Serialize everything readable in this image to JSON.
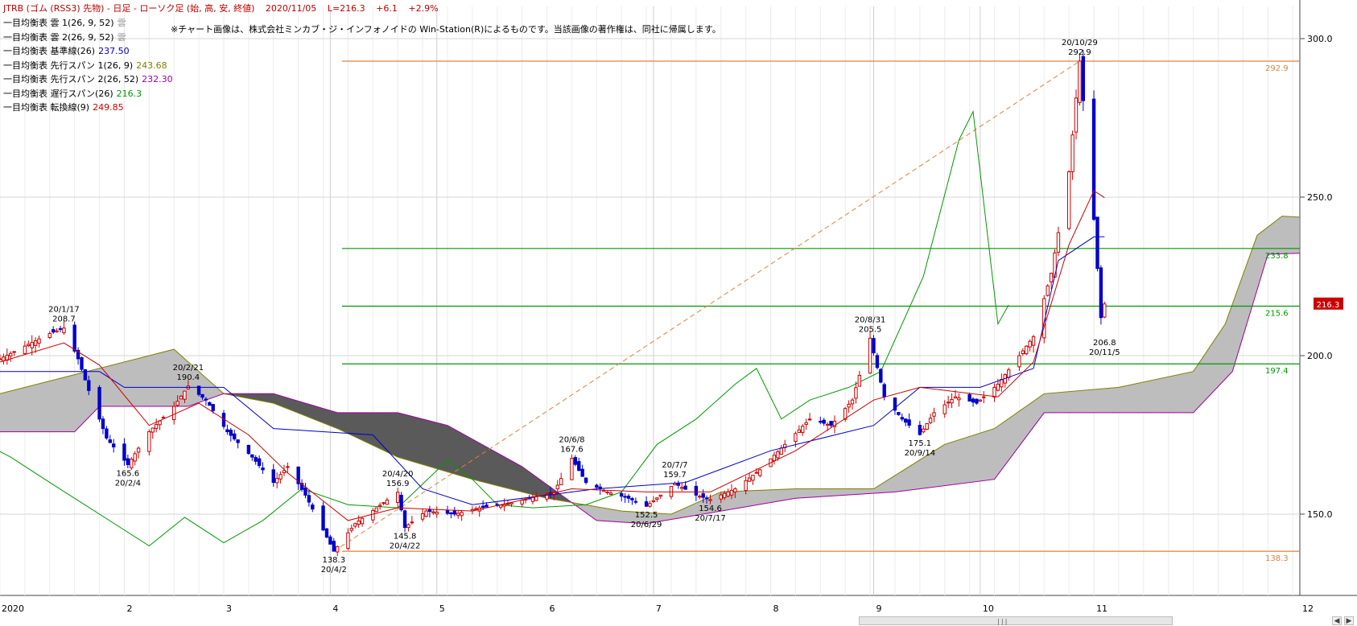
{
  "header": {
    "title": "JTRB (ゴム (RSS3) 先物) - 日足 - ローソク足 (始, 高, 安, 終値)",
    "date": "2020/11/05",
    "last": "L=216.3",
    "change": "+6.1",
    "pct": "+2.9%"
  },
  "legend": [
    {
      "label": "一目均衡表 雲 1(26, 9, 52)",
      "value": "雲",
      "color": "#999999"
    },
    {
      "label": "一目均衡表 雲 2(26, 9, 52)",
      "value": "雲",
      "color": "#999999"
    },
    {
      "label": "一目均衡表 基準線(26)",
      "value": "237.50",
      "color": "#0000cc"
    },
    {
      "label": "一目均衡表 先行スパン 1(26, 9)",
      "value": "243.68",
      "color": "#808000"
    },
    {
      "label": "一目均衡表 先行スパン 2(26, 52)",
      "value": "232.30",
      "color": "#a000a0"
    },
    {
      "label": "一目均衡表 遅行スパン(26)",
      "value": "216.3",
      "color": "#009900"
    },
    {
      "label": "一目均衡表 転換線(9)",
      "value": "249.85",
      "color": "#cc0000"
    }
  ],
  "note": "※チャート画像は、株式会社ミンカブ・ジ・インフォノイドの Win-Station(R)によるものです。当該画像の著作権は、同社に帰属します。",
  "colors": {
    "up": "#cc0000",
    "down": "#0000cc",
    "kijun": "#0000cc",
    "tenkan": "#cc0000",
    "chikou": "#009900",
    "span1": "#808000",
    "span2": "#a000a0",
    "cloud_bull": "#bdbdbd",
    "cloud_bear": "#5a5a5a",
    "hline_green": "#009900",
    "hline_orange": "#e08040",
    "price_box": "#cc0000"
  },
  "chart_data": {
    "type": "candlestick",
    "ylim": [
      130,
      305
    ],
    "yticks": [
      "300.0",
      "250.0",
      "200.0",
      "150.0"
    ],
    "months": [
      "2020",
      "2",
      "3",
      "4",
      "5",
      "6",
      "7",
      "8",
      "9",
      "10",
      "11",
      "12"
    ],
    "current_price_label": "216.3",
    "hlines": [
      {
        "value": 292.9,
        "label": "292.9",
        "color": "orange"
      },
      {
        "value": 233.8,
        "label": "233.8",
        "color": "green"
      },
      {
        "value": 215.6,
        "label": "215.6",
        "color": "green"
      },
      {
        "value": 197.4,
        "label": "197.4",
        "color": "green"
      },
      {
        "value": 138.3,
        "label": "138.3",
        "color": "orange"
      }
    ],
    "trendline": {
      "from": [
        "20/4/2",
        138.3
      ],
      "to": [
        "20/10/29",
        292.9
      ]
    },
    "annotations": [
      {
        "date": "20/1/17",
        "value": "208.7",
        "pos": "above"
      },
      {
        "date": "20/2/4",
        "value": "165.6",
        "pos": "below"
      },
      {
        "date": "20/2/21",
        "value": "190.4",
        "pos": "above"
      },
      {
        "date": "20/4/2",
        "value": "138.3",
        "pos": "below"
      },
      {
        "date": "20/4/20",
        "value": "156.9",
        "pos": "above"
      },
      {
        "date": "20/4/22",
        "value": "145.8",
        "pos": "below"
      },
      {
        "date": "20/6/8",
        "value": "167.6",
        "pos": "above"
      },
      {
        "date": "20/6/29",
        "value": "152.5",
        "pos": "below"
      },
      {
        "date": "20/7/7",
        "value": "159.7",
        "pos": "above"
      },
      {
        "date": "20/7/17",
        "value": "154.6",
        "pos": "below"
      },
      {
        "date": "20/8/31",
        "value": "205.5",
        "pos": "above"
      },
      {
        "date": "20/9/14",
        "value": "175.1",
        "pos": "below"
      },
      {
        "date": "20/10/29",
        "value": "292.9",
        "pos": "above"
      },
      {
        "date": "20/11/5",
        "value": "206.8",
        "pos": "below"
      }
    ],
    "price_path": [
      [
        "2019-12-30",
        199
      ],
      [
        "2020-01-06",
        203
      ],
      [
        "2020-01-13",
        207
      ],
      [
        "2020-01-17",
        208.7
      ],
      [
        "2020-01-21",
        199
      ],
      [
        "2020-01-24",
        189
      ],
      [
        "2020-01-29",
        174
      ],
      [
        "2020-02-04",
        165.6
      ],
      [
        "2020-02-10",
        176
      ],
      [
        "2020-02-17",
        184
      ],
      [
        "2020-02-21",
        190.4
      ],
      [
        "2020-02-26",
        186
      ],
      [
        "2020-03-03",
        176
      ],
      [
        "2020-03-10",
        168
      ],
      [
        "2020-03-16",
        160
      ],
      [
        "2020-03-20",
        165
      ],
      [
        "2020-03-25",
        156
      ],
      [
        "2020-03-30",
        145
      ],
      [
        "2020-04-02",
        138.3
      ],
      [
        "2020-04-08",
        147
      ],
      [
        "2020-04-14",
        152
      ],
      [
        "2020-04-20",
        156.9
      ],
      [
        "2020-04-22",
        145.8
      ],
      [
        "2020-04-28",
        151
      ],
      [
        "2020-05-06",
        150
      ],
      [
        "2020-05-13",
        152
      ],
      [
        "2020-05-20",
        153
      ],
      [
        "2020-05-27",
        155
      ],
      [
        "2020-06-03",
        157
      ],
      [
        "2020-06-08",
        167.6
      ],
      [
        "2020-06-12",
        160
      ],
      [
        "2020-06-18",
        157
      ],
      [
        "2020-06-24",
        155
      ],
      [
        "2020-06-29",
        152.5
      ],
      [
        "2020-07-03",
        156
      ],
      [
        "2020-07-07",
        159.7
      ],
      [
        "2020-07-13",
        156
      ],
      [
        "2020-07-17",
        154.6
      ],
      [
        "2020-07-24",
        158
      ],
      [
        "2020-07-31",
        164
      ],
      [
        "2020-08-07",
        172
      ],
      [
        "2020-08-14",
        180
      ],
      [
        "2020-08-20",
        178
      ],
      [
        "2020-08-26",
        186
      ],
      [
        "2020-08-31",
        205.5
      ],
      [
        "2020-09-04",
        187
      ],
      [
        "2020-09-09",
        180
      ],
      [
        "2020-09-14",
        175.1
      ],
      [
        "2020-09-18",
        182
      ],
      [
        "2020-09-24",
        187
      ],
      [
        "2020-09-30",
        185
      ],
      [
        "2020-10-06",
        191
      ],
      [
        "2020-10-12",
        200
      ],
      [
        "2020-10-16",
        206
      ],
      [
        "2020-10-21",
        226
      ],
      [
        "2020-10-26",
        258
      ],
      [
        "2020-10-29",
        292.9
      ],
      [
        "2020-11-02",
        243
      ],
      [
        "2020-11-04",
        212
      ],
      [
        "2020-11-05",
        216.3
      ]
    ],
    "kijun_path": [
      [
        "2019-12-30",
        195
      ],
      [
        "2020-01-27",
        195
      ],
      [
        "2020-02-03",
        190
      ],
      [
        "2020-03-02",
        190
      ],
      [
        "2020-03-16",
        177
      ],
      [
        "2020-04-13",
        175
      ],
      [
        "2020-04-27",
        158
      ],
      [
        "2020-05-11",
        153
      ],
      [
        "2020-06-15",
        158
      ],
      [
        "2020-07-10",
        160
      ],
      [
        "2020-08-03",
        170
      ],
      [
        "2020-09-01",
        178
      ],
      [
        "2020-09-14",
        190
      ],
      [
        "2020-10-01",
        190
      ],
      [
        "2020-10-16",
        196
      ],
      [
        "2020-10-23",
        230
      ],
      [
        "2020-11-02",
        237.5
      ],
      [
        "2020-11-05",
        237.5
      ]
    ],
    "tenkan_path": [
      [
        "2019-12-30",
        198
      ],
      [
        "2020-01-17",
        204
      ],
      [
        "2020-01-27",
        197
      ],
      [
        "2020-02-10",
        178
      ],
      [
        "2020-02-24",
        185
      ],
      [
        "2020-03-09",
        175
      ],
      [
        "2020-03-20",
        163
      ],
      [
        "2020-04-06",
        148
      ],
      [
        "2020-04-20",
        152
      ],
      [
        "2020-05-11",
        151
      ],
      [
        "2020-06-08",
        158
      ],
      [
        "2020-06-29",
        157
      ],
      [
        "2020-07-17",
        157
      ],
      [
        "2020-08-10",
        170
      ],
      [
        "2020-09-01",
        186
      ],
      [
        "2020-09-14",
        190
      ],
      [
        "2020-10-06",
        187
      ],
      [
        "2020-10-16",
        198
      ],
      [
        "2020-10-26",
        235
      ],
      [
        "2020-11-02",
        252
      ],
      [
        "2020-11-05",
        249.85
      ]
    ],
    "chikou_path": [
      [
        "2019-12-02",
        182
      ],
      [
        "2019-12-16",
        178
      ],
      [
        "2020-01-02",
        168
      ],
      [
        "2020-01-13",
        160
      ],
      [
        "2020-01-27",
        150
      ],
      [
        "2020-02-10",
        140
      ],
      [
        "2020-02-20",
        149
      ],
      [
        "2020-03-02",
        141
      ],
      [
        "2020-03-13",
        148
      ],
      [
        "2020-03-24",
        158
      ],
      [
        "2020-04-06",
        153
      ],
      [
        "2020-04-20",
        152
      ],
      [
        "2020-05-04",
        167
      ],
      [
        "2020-05-11",
        161
      ],
      [
        "2020-05-18",
        153
      ],
      [
        "2020-05-28",
        152
      ],
      [
        "2020-06-12",
        153
      ],
      [
        "2020-06-22",
        157
      ],
      [
        "2020-07-02",
        172
      ],
      [
        "2020-07-13",
        180
      ],
      [
        "2020-07-24",
        191
      ],
      [
        "2020-07-30",
        196
      ],
      [
        "2020-08-06",
        180
      ],
      [
        "2020-08-14",
        186
      ],
      [
        "2020-08-25",
        190
      ],
      [
        "2020-09-03",
        195
      ],
      [
        "2020-09-15",
        225
      ],
      [
        "2020-09-25",
        268
      ],
      [
        "2020-09-29",
        277
      ],
      [
        "2020-10-06",
        210
      ],
      [
        "2020-10-09",
        216
      ]
    ],
    "span1_path": [
      [
        "2019-12-30",
        188
      ],
      [
        "2020-01-20",
        194
      ],
      [
        "2020-02-10",
        200
      ],
      [
        "2020-02-17",
        202
      ],
      [
        "2020-03-02",
        188
      ],
      [
        "2020-03-16",
        185
      ],
      [
        "2020-04-03",
        177
      ],
      [
        "2020-04-20",
        168
      ],
      [
        "2020-05-11",
        161
      ],
      [
        "2020-06-01",
        155
      ],
      [
        "2020-06-22",
        151
      ],
      [
        "2020-07-06",
        150
      ],
      [
        "2020-07-20",
        157
      ],
      [
        "2020-08-10",
        158
      ],
      [
        "2020-09-01",
        158
      ],
      [
        "2020-09-21",
        172
      ],
      [
        "2020-10-05",
        177
      ],
      [
        "2020-10-19",
        188
      ],
      [
        "2020-11-09",
        190
      ],
      [
        "2020-11-30",
        195
      ],
      [
        "2020-12-09",
        210
      ],
      [
        "2020-12-18",
        238
      ],
      [
        "2020-12-25",
        244
      ],
      [
        "2020-12-30",
        243.68
      ]
    ],
    "span2_path": [
      [
        "2019-12-30",
        176
      ],
      [
        "2020-01-20",
        176
      ],
      [
        "2020-01-27",
        184
      ],
      [
        "2020-02-21",
        184
      ],
      [
        "2020-03-02",
        188
      ],
      [
        "2020-03-16",
        188
      ],
      [
        "2020-04-03",
        182
      ],
      [
        "2020-04-20",
        182
      ],
      [
        "2020-05-04",
        178
      ],
      [
        "2020-05-25",
        165
      ],
      [
        "2020-06-15",
        148
      ],
      [
        "2020-06-29",
        147
      ],
      [
        "2020-07-20",
        151
      ],
      [
        "2020-08-10",
        155
      ],
      [
        "2020-09-07",
        157
      ],
      [
        "2020-10-05",
        161
      ],
      [
        "2020-10-19",
        182
      ],
      [
        "2020-11-30",
        182
      ],
      [
        "2020-12-11",
        195
      ],
      [
        "2020-12-21",
        232
      ],
      [
        "2020-12-30",
        232.3
      ]
    ]
  }
}
